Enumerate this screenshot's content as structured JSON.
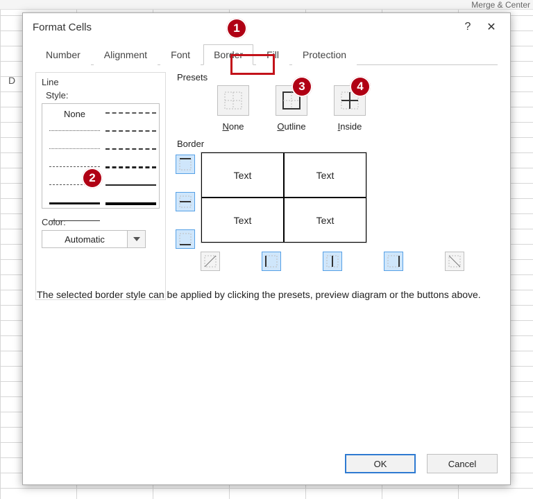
{
  "ribbon": {
    "merge": "Merge & Center"
  },
  "sheet": {
    "col": "D"
  },
  "dialog": {
    "title": "Format Cells",
    "help": "?",
    "close": "✕",
    "tabs": {
      "number": "Number",
      "alignment": "Alignment",
      "font": "Font",
      "border": "Border",
      "fill": "Fill",
      "protection": "Protection",
      "active": "border"
    },
    "line": {
      "label": "Line",
      "style_label": "Style:",
      "none": "None",
      "color_label": "Color:",
      "color_value": "Automatic"
    },
    "presets": {
      "label": "Presets",
      "none": "None",
      "outline": "Outline",
      "inside": "Inside"
    },
    "border": {
      "label": "Border",
      "cell_text": "Text"
    },
    "hint": "The selected border style can be applied by clicking the presets, preview diagram or the buttons above.",
    "ok": "OK",
    "cancel": "Cancel"
  },
  "annotations": [
    "1",
    "2",
    "3",
    "4"
  ]
}
